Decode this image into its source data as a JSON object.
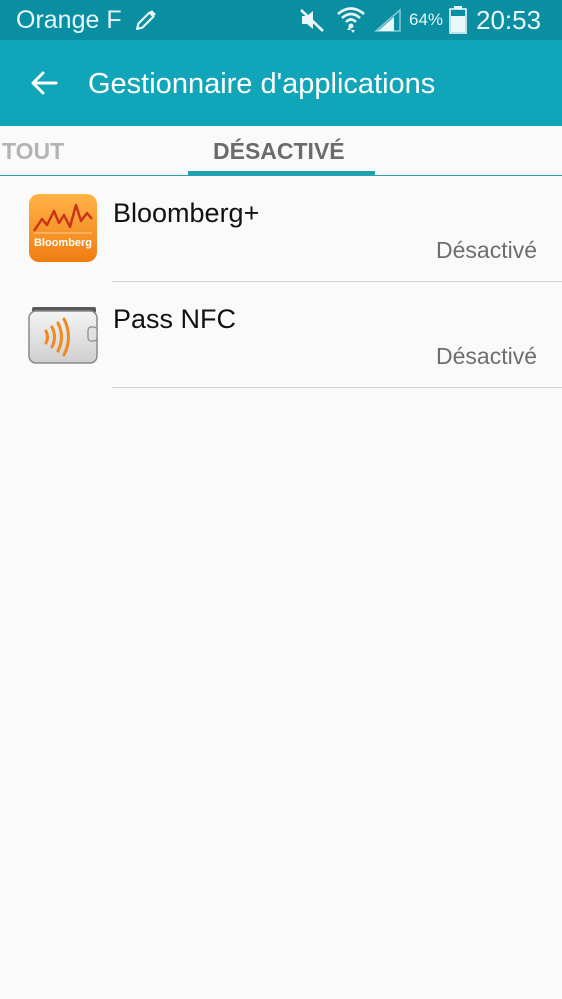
{
  "status_bar": {
    "carrier": "Orange F",
    "battery_percent": "64%",
    "time": "20:53",
    "icons": [
      "pencil-icon",
      "mute-icon",
      "wifi-icon",
      "signal-icon",
      "battery-icon"
    ]
  },
  "app_bar": {
    "title": "Gestionnaire d'applications",
    "back_icon": "arrow-left-icon"
  },
  "tabs": [
    {
      "label": "TOUT",
      "selected": false
    },
    {
      "label": "DÉSACTIVÉ",
      "selected": true
    }
  ],
  "apps": [
    {
      "name": "Bloomberg+",
      "status": "Désactivé",
      "icon": "bloomberg-app-icon",
      "icon_text": "Bloomberg"
    },
    {
      "name": "Pass NFC",
      "status": "Désactivé",
      "icon": "nfc-wallet-icon"
    }
  ],
  "colors": {
    "status_bar": "#0a8ea2",
    "app_bar": "#10a5b9",
    "tab_indicator": "#1ea2b1",
    "background": "#fafafa"
  }
}
